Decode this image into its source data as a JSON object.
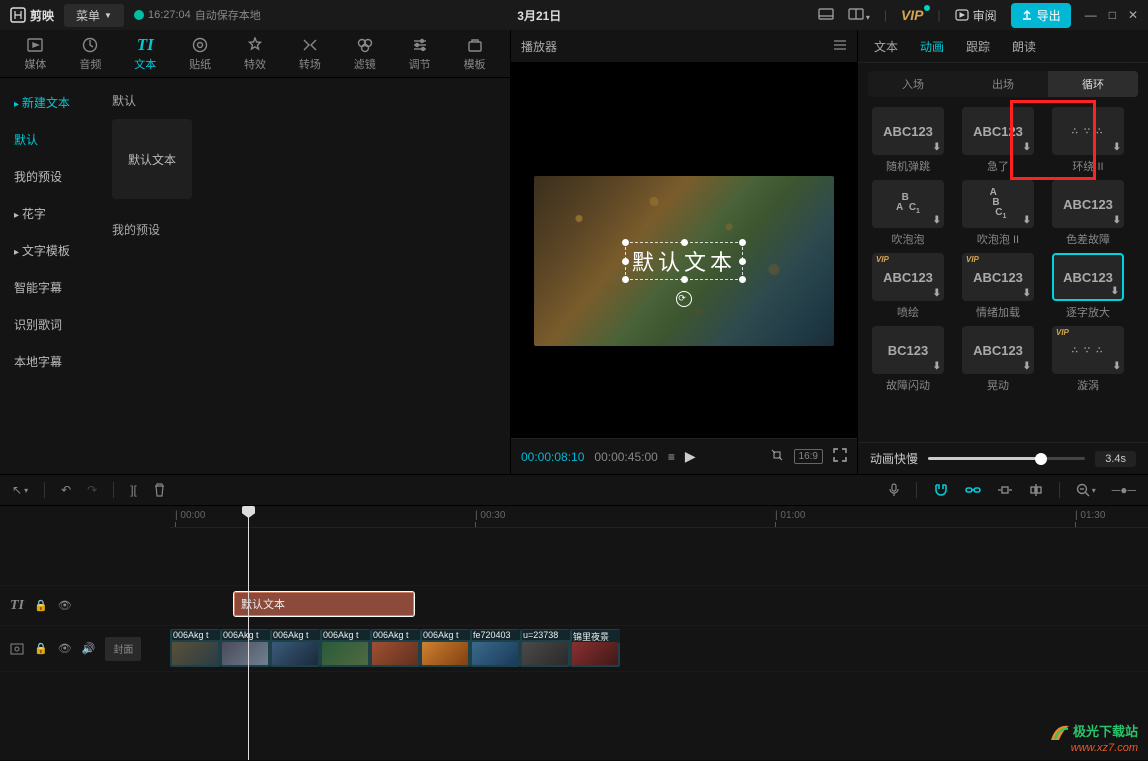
{
  "titlebar": {
    "app_name": "剪映",
    "menu": "菜单",
    "save_time": "16:27:04",
    "save_text": "自动保存本地",
    "project": "3月21日",
    "review": "审阅",
    "export": "导出",
    "vip": "VIP"
  },
  "top_tabs": [
    "媒体",
    "音频",
    "文本",
    "贴纸",
    "特效",
    "转场",
    "滤镜",
    "调节",
    "模板"
  ],
  "top_tab_active_index": 2,
  "sidebar": {
    "items": [
      {
        "label": "新建文本",
        "active": true,
        "sub": true
      },
      {
        "label": "默认",
        "active": true,
        "sub": false
      },
      {
        "label": "我的预设",
        "active": false,
        "sub": false
      },
      {
        "label": "花字",
        "active": false,
        "sub": true
      },
      {
        "label": "文字模板",
        "active": false,
        "sub": true
      },
      {
        "label": "智能字幕",
        "active": false,
        "sub": false
      },
      {
        "label": "识别歌词",
        "active": false,
        "sub": false
      },
      {
        "label": "本地字幕",
        "active": false,
        "sub": false
      }
    ]
  },
  "content": {
    "section1": "默认",
    "card1": "默认文本",
    "section2": "我的预设"
  },
  "player": {
    "title": "播放器",
    "overlay_text": "默认文本",
    "time_current": "00:00:08:10",
    "time_total": "00:00:45:00",
    "ratio": "16:9"
  },
  "right": {
    "tabs": [
      "文本",
      "动画",
      "跟踪",
      "朗读"
    ],
    "tab_active_index": 1,
    "sub_tabs": [
      "入场",
      "出场",
      "循环"
    ],
    "sub_tab_active_index": 2,
    "speed_label": "动画快慢",
    "speed_value": "3.4s",
    "anims": [
      {
        "txt": "ABC123",
        "label": "随机弹跳",
        "vip": false
      },
      {
        "txt": "ABC123",
        "label": "急了",
        "vip": false
      },
      {
        "txt": "",
        "label": "环绕 II",
        "vip": false,
        "dots": true
      },
      {
        "txt": "",
        "label": "吹泡泡",
        "vip": false,
        "bubA": true
      },
      {
        "txt": "",
        "label": "吹泡泡 II",
        "vip": false,
        "bubB": true
      },
      {
        "txt": "ABC123",
        "label": "色差故障",
        "vip": false
      },
      {
        "txt": "ABC123",
        "label": "喷绘",
        "vip": true
      },
      {
        "txt": "ABC123",
        "label": "情绪加载",
        "vip": true
      },
      {
        "txt": "ABC123",
        "label": "逐字放大",
        "vip": false,
        "selected": true
      },
      {
        "txt": "BC123",
        "label": "故障闪动",
        "vip": false
      },
      {
        "txt": "ABC123",
        "label": "晃动",
        "vip": false
      },
      {
        "txt": "",
        "label": "漩涡",
        "vip": true,
        "dots": true
      }
    ]
  },
  "ruler": [
    "00:00",
    "00:30",
    "01:00",
    "01:30"
  ],
  "text_clip_label": "默认文本",
  "cover_label": "封面",
  "clips": [
    {
      "label": "006Akg t",
      "bg": "linear-gradient(135deg,#5a5038,#2a3d45)"
    },
    {
      "label": "006Akg t",
      "bg": "linear-gradient(135deg,#4a4a5a,#708090)"
    },
    {
      "label": "006Akg t",
      "bg": "linear-gradient(135deg,#3a5a7a,#1a2a3a)"
    },
    {
      "label": "006Akg t",
      "bg": "linear-gradient(135deg,#2a5a3a,#506a40)"
    },
    {
      "label": "006Akg t",
      "bg": "linear-gradient(135deg,#a05030,#603020)"
    },
    {
      "label": "006Akg t",
      "bg": "linear-gradient(135deg,#d08030,#804010)"
    },
    {
      "label": "fe720403",
      "bg": "linear-gradient(135deg,#3a6a8a,#1a3a5a)"
    },
    {
      "label": "u=23738",
      "bg": "linear-gradient(135deg,#4a4a4a,#2a2a2a)"
    },
    {
      "label": "锦里夜景",
      "bg": "linear-gradient(135deg,#8a3030,#401818)"
    }
  ],
  "watermark": {
    "text": "极光下载站",
    "url": "www.xz7.com"
  }
}
